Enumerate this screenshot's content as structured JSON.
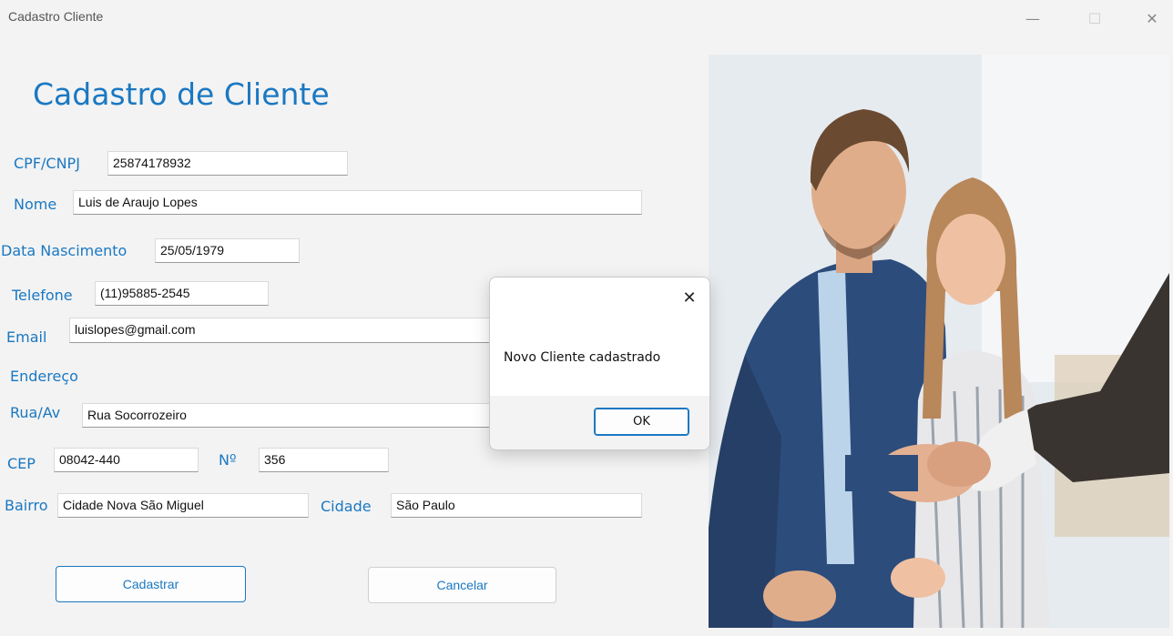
{
  "window": {
    "title": "Cadastro Cliente",
    "minimize_glyph": "—",
    "maximize_glyph": "☐",
    "close_glyph": "✕"
  },
  "form": {
    "title": "Cadastro de Cliente",
    "cpf": {
      "label": "CPF/CNPJ",
      "value": "25874178932"
    },
    "nome": {
      "label": "Nome",
      "value": "Luis de Araujo Lopes"
    },
    "nascimento": {
      "label": "Data Nascimento",
      "value": "25/05/1979"
    },
    "telefone": {
      "label": "Telefone",
      "value": "(11)95885-2545"
    },
    "email": {
      "label": "Email",
      "value": "luislopes@gmail.com"
    },
    "endereco_label": "Endereço",
    "rua": {
      "label": "Rua/Av",
      "value": "Rua Socorrozeiro"
    },
    "cep": {
      "label": "CEP",
      "value": "08042-440"
    },
    "numero": {
      "label": "Nº",
      "value": "356"
    },
    "bairro": {
      "label": "Bairro",
      "value": "Cidade Nova São Miguel"
    },
    "cidade": {
      "label": "Cidade",
      "value": "São Paulo"
    }
  },
  "buttons": {
    "cadastrar": "Cadastrar",
    "cancelar": "Cancelar"
  },
  "dialog": {
    "message": "Novo Cliente cadastrado",
    "ok": "OK",
    "close_glyph": "✕"
  },
  "colors": {
    "accent": "#1a78c2",
    "background": "#f3f3f3"
  }
}
